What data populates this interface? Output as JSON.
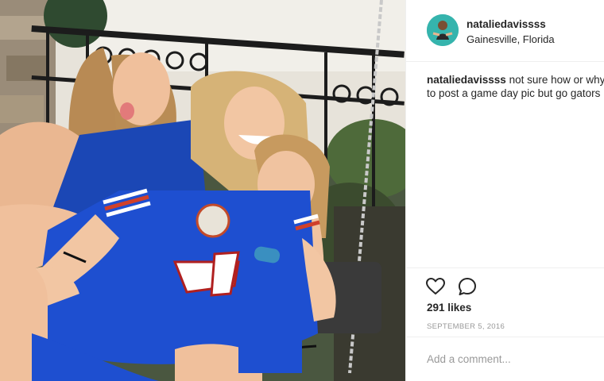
{
  "post": {
    "username": "nataliedavissss",
    "location": "Gainesville, Florida",
    "caption": {
      "user": "nataliedavissss",
      "text": "not sure how or why\nto post a game day pic but go gators"
    },
    "likes": "291 likes",
    "date": "SEPTEMBER 5, 2016",
    "comment_placeholder": "Add a comment...",
    "icons": {
      "like": "heart-icon",
      "comment": "comment-bubble-icon"
    }
  }
}
